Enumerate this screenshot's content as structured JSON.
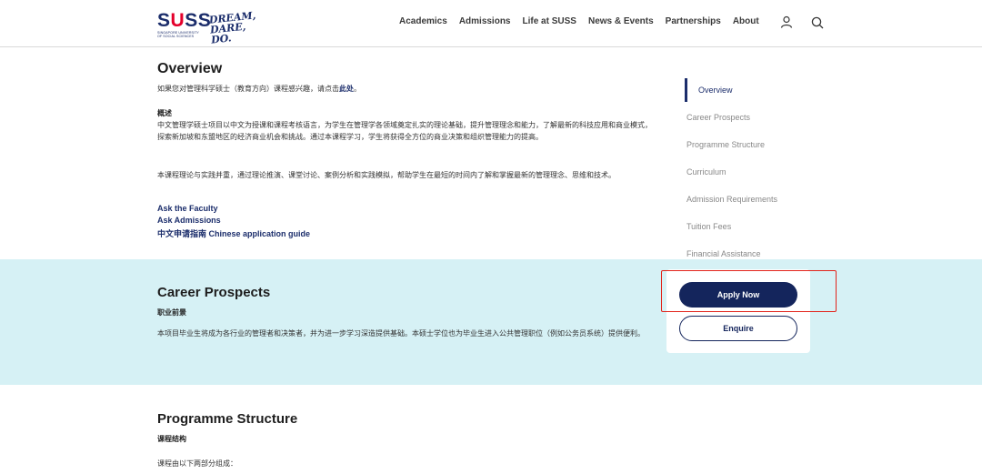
{
  "brand": {
    "logo_text_s1": "S",
    "logo_text_u": "U",
    "logo_text_ss": "SS",
    "logo_subtitle": "SINGAPORE UNIVERSITY OF SOCIAL SCIENCES",
    "tagline_line1": "DREAM,",
    "tagline_line2": "DARE, DO.",
    "colors": {
      "primary": "#1b2d6b",
      "accent": "#e4002b",
      "band": "#d6f1f5"
    }
  },
  "nav": {
    "items": [
      "Academics",
      "Admissions",
      "Life at SUSS",
      "News & Events",
      "Partnerships",
      "About"
    ],
    "user_icon": "user-icon",
    "search_icon": "search-icon"
  },
  "overview": {
    "title": "Overview",
    "intro_prefix": "如果您对管理科学硕士（教育方向）课程感兴趣，请点击",
    "intro_link": "此处",
    "intro_suffix": "。",
    "summary_heading": "概述",
    "para1": "中文管理学硕士项目以中文为授课和课程考核语言，为学生在管理学各领域奠定扎实的理论基础，提升管理理念和能力，了解最新的科技应用和商业模式，探索新加坡和东盟地区的经济商业机会和挑战。通过本课程学习，学生将获得全方位的商业决策和组织管理能力的提高。",
    "para2": "本课程理论与实践并重，通过理论推演、课堂讨论、案例分析和实践模拟，帮助学生在最短的时间内了解和掌握最新的管理理念、思维和技术。",
    "links": [
      "Ask the Faculty",
      "Ask Admissions",
      "中文申请指南 Chinese application guide"
    ]
  },
  "career": {
    "title": "Career Prospects",
    "subtitle": "职业前景",
    "text": "本项目毕业生将成为各行业的管理者和决策者，并为进一步学习深造提供基础。本硕士学位也为毕业生进入公共管理职位（例如公务员系统）提供便利。"
  },
  "programme": {
    "title": "Programme Structure",
    "subtitle": "课程结构",
    "text": "课程由以下两部分组成："
  },
  "side_nav": {
    "items": [
      "Overview",
      "Career Prospects",
      "Programme Structure",
      "Curriculum",
      "Admission Requirements",
      "Tuition Fees",
      "Financial Assistance"
    ]
  },
  "cta": {
    "apply_label": "Apply Now",
    "enquire_label": "Enquire"
  }
}
